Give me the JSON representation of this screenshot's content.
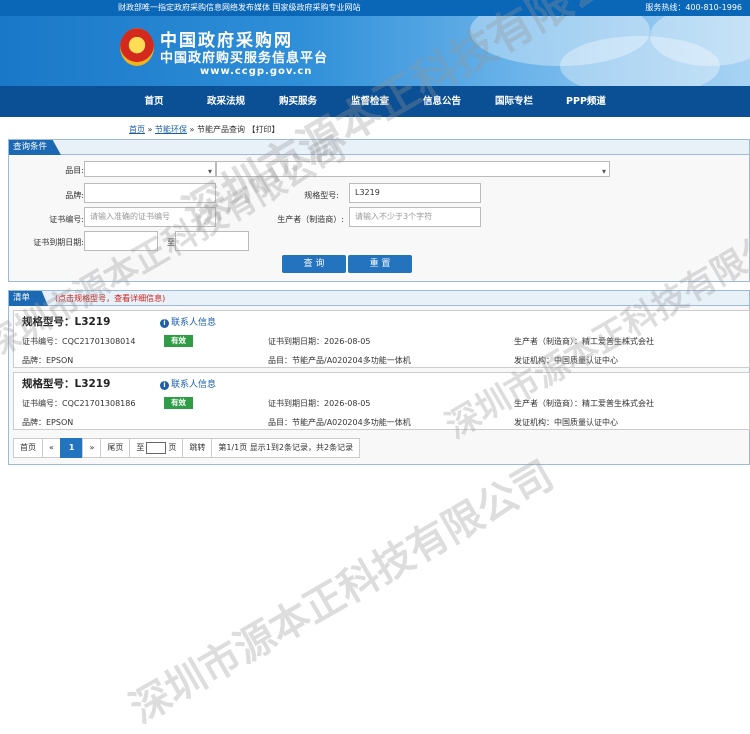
{
  "topbar": {
    "notice": "财政部唯一指定政府采购信息网络发布媒体 国家级政府采购专业网站",
    "hotline": "服务热线：400-810-1996"
  },
  "banner": {
    "title_line1": "中国政府采购网",
    "title_line2": "中国政府购买服务信息平台",
    "url": "www.ccgp.gov.cn"
  },
  "nav": [
    "首页",
    "政采法规",
    "购买服务",
    "监督检查",
    "信息公告",
    "国际专栏",
    "PPP频道"
  ],
  "breadcrumb": {
    "home": "首页",
    "sep1": "»",
    "section": "节能环保",
    "sep2": "»",
    "page": "节能产品查询",
    "print": "【打印】"
  },
  "query": {
    "tab": "查询条件",
    "labels": {
      "category": "品目:",
      "brand": "品牌:",
      "model": "规格型号:",
      "cert_no": "证书编号:",
      "maker": "生产者（制造商）:",
      "expire": "证书到期日期:",
      "to": "至"
    },
    "model_value": "L3219",
    "cert_placeholder": "请输入准确的证书编号",
    "maker_placeholder": "请输入不少于3个字符",
    "query_button": "查 询",
    "reset_button": "重 置"
  },
  "results": {
    "tab": "清单",
    "hint": "(点击规格型号，查看详细信息)",
    "contact_label": "联系人信息",
    "items": [
      {
        "model": "规格型号：L3219",
        "cert_no": "证书编号：CQC21701308014",
        "status": "有效",
        "expire": "证书到期日期：2026-08-05",
        "maker": "生产者（制造商）：精工爱普生株式会社",
        "brand": "品牌：EPSON",
        "category": "品目：节能产品/A020204多功能一体机",
        "issuer": "发证机构：中国质量认证中心"
      },
      {
        "model": "规格型号：L3219",
        "cert_no": "证书编号：CQC21701308186",
        "status": "有效",
        "expire": "证书到期日期：2026-08-05",
        "maker": "生产者（制造商）：精工爱普生株式会社",
        "brand": "品牌：EPSON",
        "category": "品目：节能产品/A020204多功能一体机",
        "issuer": "发证机构：中国质量认证中心"
      }
    ]
  },
  "pager": {
    "first": "首页",
    "prev": "«",
    "current": "1",
    "next": "»",
    "last": "尾页",
    "goto_prefix": "至",
    "goto_suffix": "页",
    "jump": "跳转",
    "summary": "第1/1页  显示1到2条记录，共2条记录"
  },
  "watermark": "深圳市源本正科技有限公司",
  "colors": {
    "primary": "#1b69b3",
    "nav": "#0b4f94",
    "valid": "#2e9d45",
    "hint": "#d0201a"
  }
}
